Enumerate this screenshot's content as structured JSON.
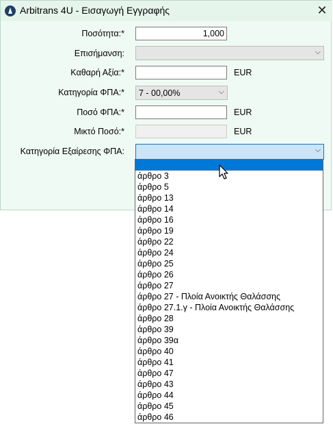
{
  "window": {
    "title": "Arbitrans 4U - Εισαγωγή Εγγραφής",
    "close_glyph": "✕",
    "icon": "arbitrans-logo-icon"
  },
  "form": {
    "quantity": {
      "label": "Ποσότητα:*",
      "value": "1,000"
    },
    "flag": {
      "label": "Επισήμανση:",
      "value": ""
    },
    "net_value": {
      "label": "Καθαρή Αξία:*",
      "value": "",
      "unit": "EUR"
    },
    "vat_category": {
      "label": "Κατηγορία ΦΠΑ:*",
      "value": "7 - 00,00%"
    },
    "vat_amount": {
      "label": "Ποσό ΦΠΑ:*",
      "value": "",
      "unit": "EUR"
    },
    "gross_amount": {
      "label": "Μικτό Ποσό:*",
      "value": "",
      "unit": "EUR"
    },
    "vat_exemption": {
      "label": "Κατηγορία Εξαίρεσης ΦΠΑ:",
      "value": ""
    }
  },
  "dropdown_options": [
    "",
    "άρθρο 3",
    "άρθρο 5",
    "άρθρο 13",
    "άρθρο 14",
    "άρθρο 16",
    "άρθρο 19",
    "άρθρο 22",
    "άρθρο 24",
    "άρθρο 25",
    "άρθρο 26",
    "άρθρο 27",
    "άρθρο 27 - Πλοία Ανοικτής Θαλάσσης",
    "άρθρο 27.1.γ - Πλοία Ανοικτής Θαλάσσης",
    "άρθρο 28",
    "άρθρο 39",
    "άρθρο 39α",
    "άρθρο 40",
    "άρθρο 41",
    "άρθρο 47",
    "άρθρο 43",
    "άρθρο 44",
    "άρθρο 45",
    "άρθρο 46"
  ],
  "selected_option_index": 0,
  "colors": {
    "accent": "#0078d7",
    "dialog_bg": "#f0faf4",
    "focus_bg": "#cce4f7"
  }
}
